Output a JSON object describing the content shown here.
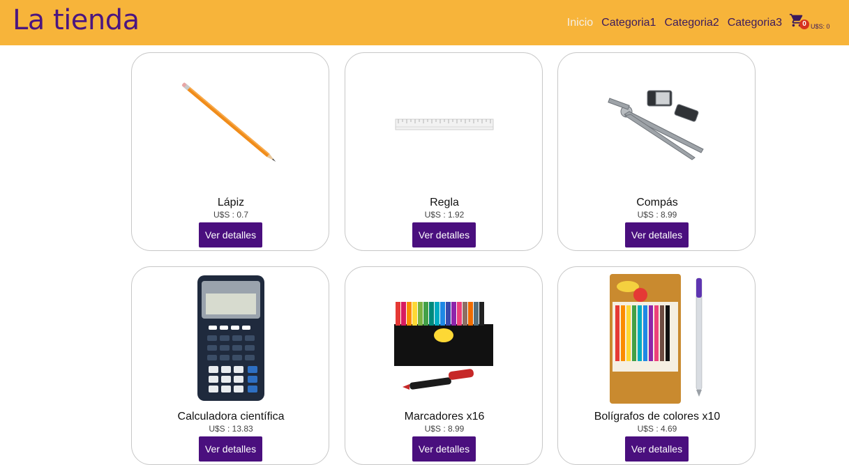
{
  "header": {
    "brand": "La tienda",
    "nav": [
      "Inicio",
      "Categoria1",
      "Categoria2",
      "Categoria3"
    ],
    "cart_count": "0",
    "cart_total": "U$S: 0"
  },
  "colors": {
    "header_bg": "#f7b43a",
    "brand": "#4b1680",
    "button": "#4a0f7e",
    "badge": "#d7321f"
  },
  "products": [
    {
      "name": "Lápiz",
      "price": "U$S : 0.7",
      "button": "Ver detalles",
      "icon": "pencil-image"
    },
    {
      "name": "Regla",
      "price": "U$S : 1.92",
      "button": "Ver detalles",
      "icon": "ruler-image"
    },
    {
      "name": "Compás",
      "price": "U$S : 8.99",
      "button": "Ver detalles",
      "icon": "compass-image"
    },
    {
      "name": "Calculadora científica",
      "price": "U$S : 13.83",
      "button": "Ver detalles",
      "icon": "calculator-image"
    },
    {
      "name": "Marcadores x16",
      "price": "U$S : 8.99",
      "button": "Ver detalles",
      "icon": "markers-image"
    },
    {
      "name": "Bolígrafos de colores x10",
      "price": "U$S : 4.69",
      "button": "Ver detalles",
      "icon": "pens-image"
    }
  ]
}
